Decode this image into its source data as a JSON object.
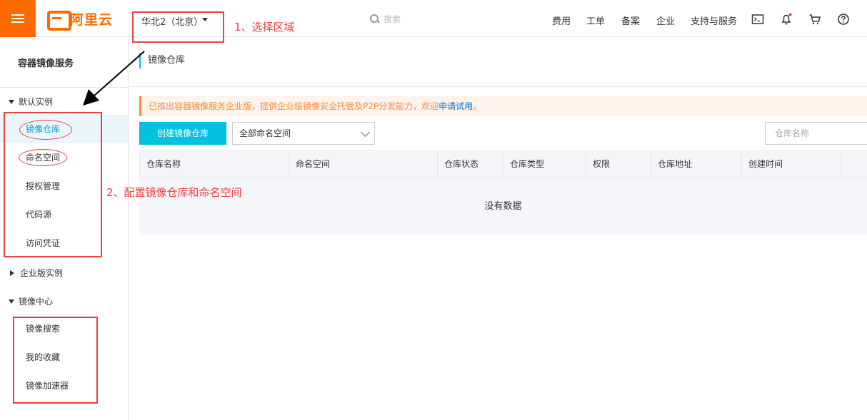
{
  "header": {
    "logo_text": "阿里云",
    "region": "华北2（北京）",
    "search_placeholder": "搜索",
    "nav": [
      "费用",
      "工单",
      "备案",
      "企业",
      "支持与服务"
    ],
    "icons": [
      "terminal-icon",
      "bell-icon",
      "cart-icon",
      "help-icon"
    ]
  },
  "annotations": {
    "step1": "1、选择区域",
    "step2": "2、配置镜像仓库和命名空间"
  },
  "sidebar": {
    "title": "容器镜像服务",
    "groups": [
      {
        "label": "默认实例",
        "expanded": true,
        "items": [
          "镜像仓库",
          "命名空间",
          "授权管理",
          "代码源",
          "访问凭证"
        ]
      },
      {
        "label": "企业版实例",
        "expanded": false
      },
      {
        "label": "镜像中心",
        "expanded": true,
        "items": [
          "镜像搜索",
          "我的收藏",
          "镜像加速器"
        ]
      }
    ],
    "active_item": "镜像仓库"
  },
  "main": {
    "title": "镜像仓库",
    "notice_text": "已推出容器镜像服务企业版，提供企业级镜像安全托管及P2P分发能力，欢迎",
    "notice_link": "申请试用",
    "notice_end": "。",
    "create_button": "创建镜像仓库",
    "namespace_select": "全部命名空间",
    "search_placeholder": "仓库名称",
    "columns": [
      "仓库名称",
      "命名空间",
      "仓库状态",
      "仓库类型",
      "权限",
      "仓库地址",
      "创建时间"
    ],
    "empty_text": "没有数据"
  },
  "colors": {
    "brand": "#ff6a00",
    "accent": "#00c1de",
    "annotation": "#e94240"
  }
}
